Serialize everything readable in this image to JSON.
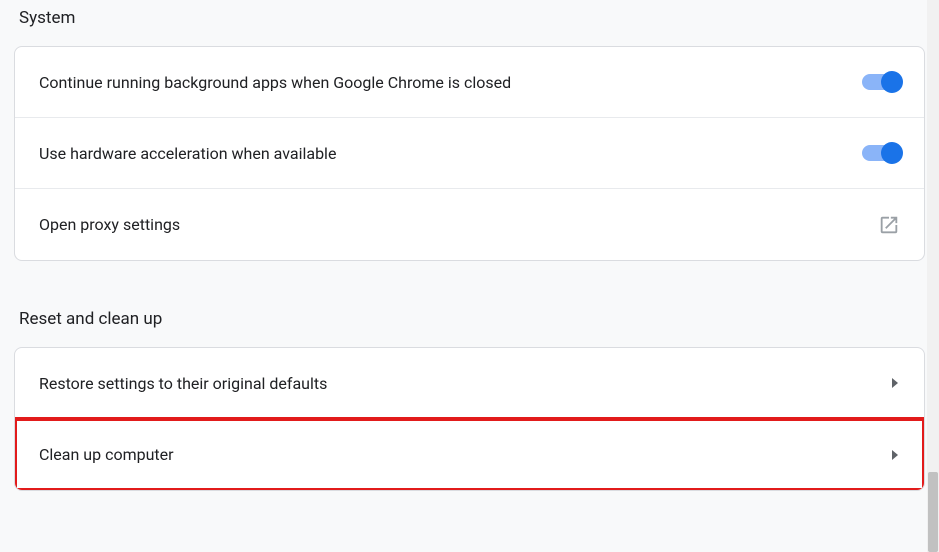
{
  "sections": {
    "system": {
      "title": "System",
      "rows": [
        {
          "label": "Continue running background apps when Google Chrome is closed"
        },
        {
          "label": "Use hardware acceleration when available"
        },
        {
          "label": "Open proxy settings"
        }
      ]
    },
    "reset": {
      "title": "Reset and clean up",
      "rows": [
        {
          "label": "Restore settings to their original defaults"
        },
        {
          "label": "Clean up computer"
        }
      ]
    }
  }
}
